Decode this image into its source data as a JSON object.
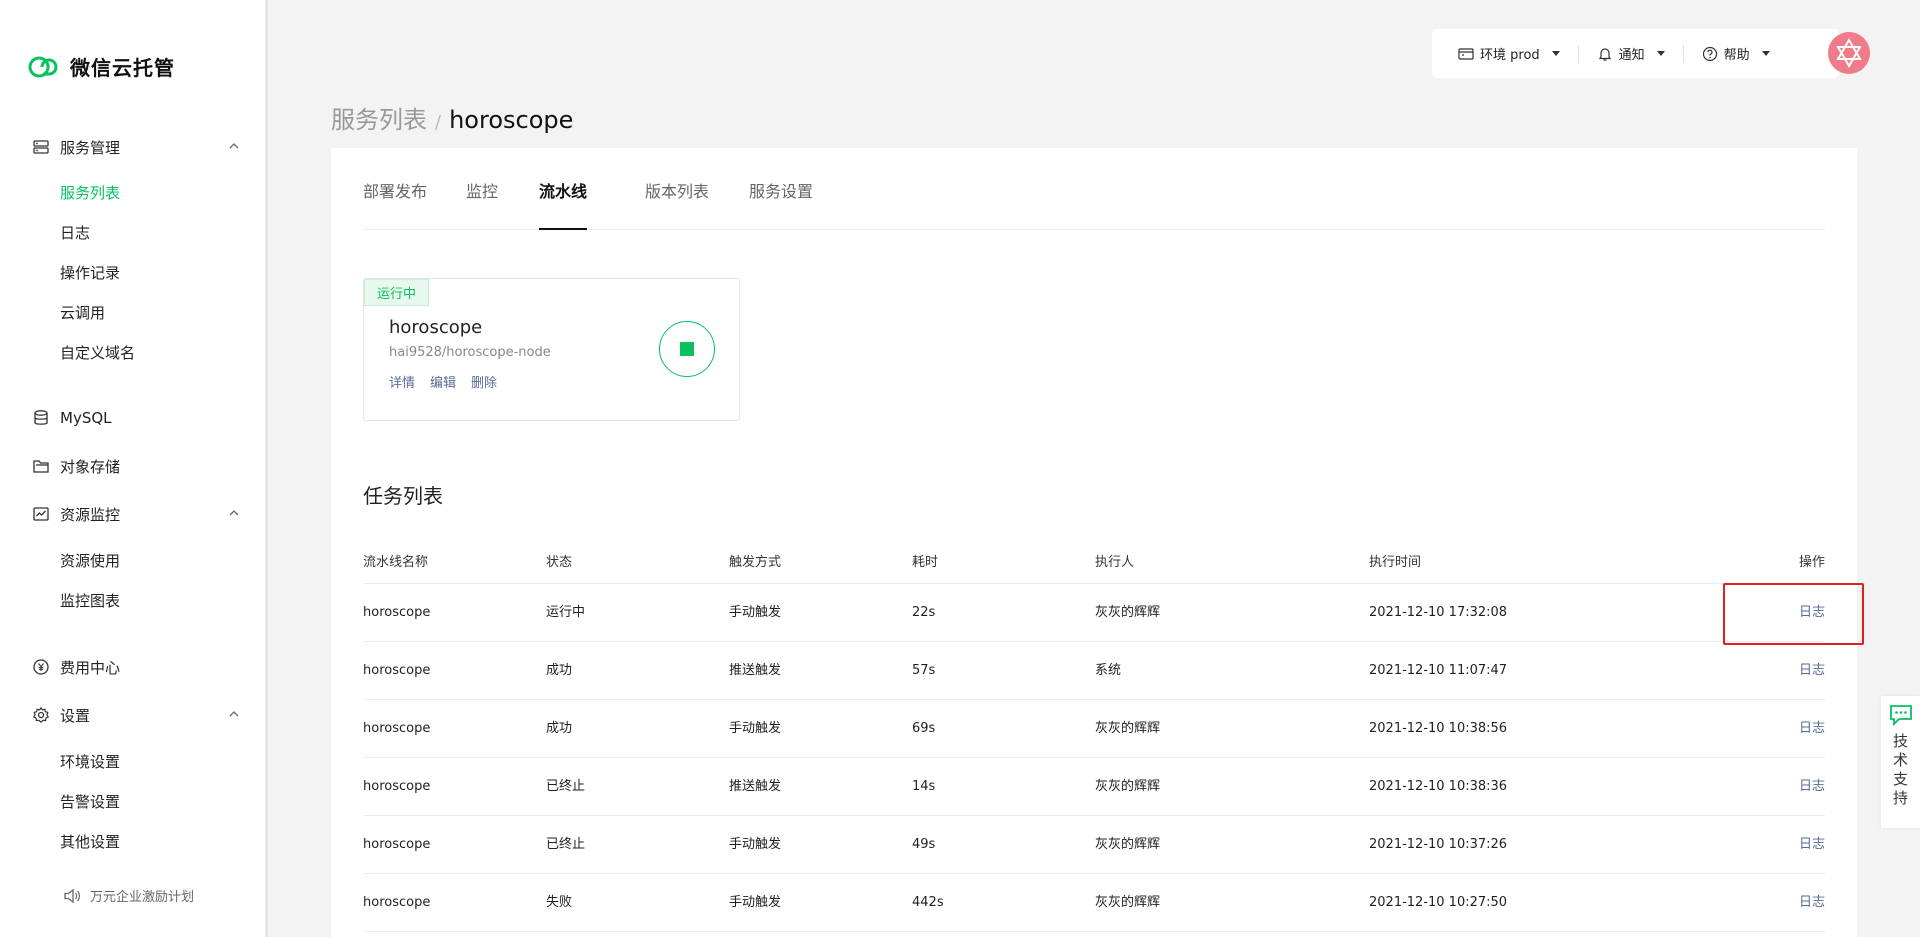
{
  "brand": {
    "name": "微信云托管",
    "color": "#07c160"
  },
  "sidebar": {
    "groups": [
      {
        "label": "服务管理",
        "items": [
          "服务列表",
          "日志",
          "操作记录",
          "云调用",
          "自定义域名"
        ]
      },
      {
        "label": "MySQL",
        "items": []
      },
      {
        "label": "对象存储",
        "items": []
      },
      {
        "label": "资源监控",
        "items": [
          "资源使用",
          "监控图表"
        ]
      },
      {
        "label": "费用中心",
        "items": []
      },
      {
        "label": "设置",
        "items": [
          "环境设置",
          "告警设置",
          "其他设置"
        ]
      }
    ],
    "active_item": "服务列表",
    "promo": "万元企业激励计划"
  },
  "topbar": {
    "env_label": "环境 prod",
    "notify_label": "通知",
    "help_label": "帮助"
  },
  "breadcrumb": {
    "parent": "服务列表",
    "separator": "/",
    "current": "horoscope"
  },
  "tabs": [
    "部署发布",
    "监控",
    "流水线",
    "版本列表",
    "服务设置"
  ],
  "active_tab": "流水线",
  "pipeline": {
    "status": "运行中",
    "name": "horoscope",
    "repo": "hai9528/horoscope-node",
    "actions": [
      "详情",
      "编辑",
      "删除"
    ]
  },
  "task_list": {
    "title": "任务列表",
    "columns": [
      "流水线名称",
      "状态",
      "触发方式",
      "耗时",
      "执行人",
      "执行时间",
      "操作"
    ],
    "rows": [
      [
        "horoscope",
        "运行中",
        "手动触发",
        "22s",
        "灰灰的辉辉",
        "2021-12-10 17:32:08",
        "日志"
      ],
      [
        "horoscope",
        "成功",
        "推送触发",
        "57s",
        "系统",
        "2021-12-10 11:07:47",
        "日志"
      ],
      [
        "horoscope",
        "成功",
        "手动触发",
        "69s",
        "灰灰的辉辉",
        "2021-12-10 10:38:56",
        "日志"
      ],
      [
        "horoscope",
        "已终止",
        "推送触发",
        "14s",
        "灰灰的辉辉",
        "2021-12-10 10:38:36",
        "日志"
      ],
      [
        "horoscope",
        "已终止",
        "手动触发",
        "49s",
        "灰灰的辉辉",
        "2021-12-10 10:37:26",
        "日志"
      ],
      [
        "horoscope",
        "失败",
        "手动触发",
        "442s",
        "灰灰的辉辉",
        "2021-12-10 10:27:50",
        "日志"
      ]
    ]
  },
  "support": {
    "label": "技术支持"
  },
  "colors": {
    "accent": "#07c160",
    "link": "#576b95",
    "highlight": "#e02020"
  }
}
